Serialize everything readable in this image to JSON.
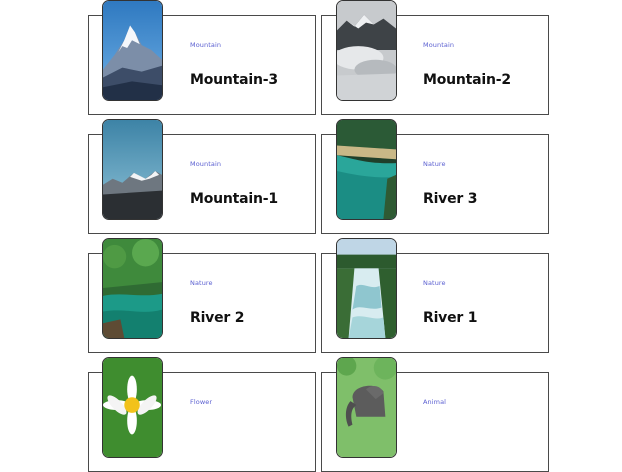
{
  "cards": [
    {
      "category": "Mountain",
      "title": "Mountain-3",
      "image": "snowy-mountain-peak-image"
    },
    {
      "category": "Mountain",
      "title": "Mountain-2",
      "image": "misty-mountain-image"
    },
    {
      "category": "Mountain",
      "title": "Mountain-1",
      "image": "mountain-range-sky-image"
    },
    {
      "category": "Nature",
      "title": "River 3",
      "image": "forest-river-image"
    },
    {
      "category": "Nature",
      "title": "River 2",
      "image": "green-river-image"
    },
    {
      "category": "Nature",
      "title": "River 1",
      "image": "rapids-river-image"
    },
    {
      "category": "Flower",
      "title": "",
      "image": "daisy-flower-image"
    },
    {
      "category": "Animal",
      "title": "",
      "image": "elephant-image"
    }
  ],
  "colors": {
    "category": "#5a5fd1",
    "title": "#111111",
    "border": "#4a4a4a"
  }
}
